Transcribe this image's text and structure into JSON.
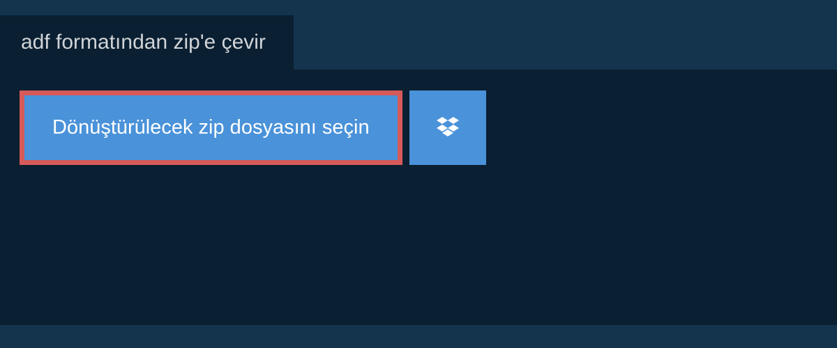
{
  "header": {
    "tab_label": "adf formatından zip'e çevir"
  },
  "actions": {
    "select_file_label": "Dönüştürülecek zip dosyasını seçin",
    "dropbox_icon": "dropbox"
  },
  "colors": {
    "background_outer": "#14344d",
    "background_panel": "#0a1f31",
    "button_primary": "#4a92d9",
    "button_highlight_border": "#d75a5a",
    "text_light": "#ffffff",
    "text_muted": "#d0d4d8"
  }
}
